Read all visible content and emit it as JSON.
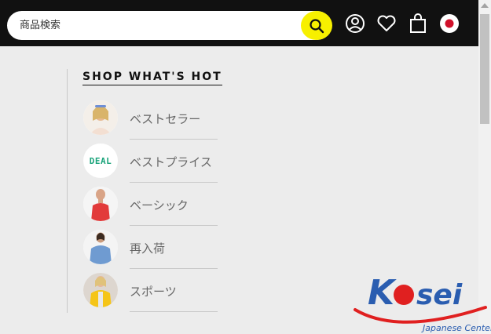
{
  "search": {
    "placeholder": "商品検索"
  },
  "header": {
    "icons": [
      "search-icon",
      "account-icon",
      "heart-icon",
      "shopping-bag-icon",
      "japan-flag-icon"
    ]
  },
  "section": {
    "title": "SHOP WHAT'S HOT",
    "items": [
      {
        "label": "ベストセラー",
        "thumb": "model-photo"
      },
      {
        "label": "ベストプライス",
        "thumb_text": "DEAL"
      },
      {
        "label": "ベーシック",
        "thumb": "model-photo"
      },
      {
        "label": "再入荷",
        "thumb": "model-photo"
      },
      {
        "label": "スポーツ",
        "thumb": "model-photo"
      }
    ]
  },
  "watermark": {
    "brand_k": "K",
    "brand_rest": "sei",
    "subtitle": "Japanese Center"
  },
  "colors": {
    "accent": "#f7f000",
    "header_bg": "#111111",
    "deal_green": "#1aa37a",
    "logo_blue": "#2a5db0",
    "logo_red": "#e02020"
  }
}
